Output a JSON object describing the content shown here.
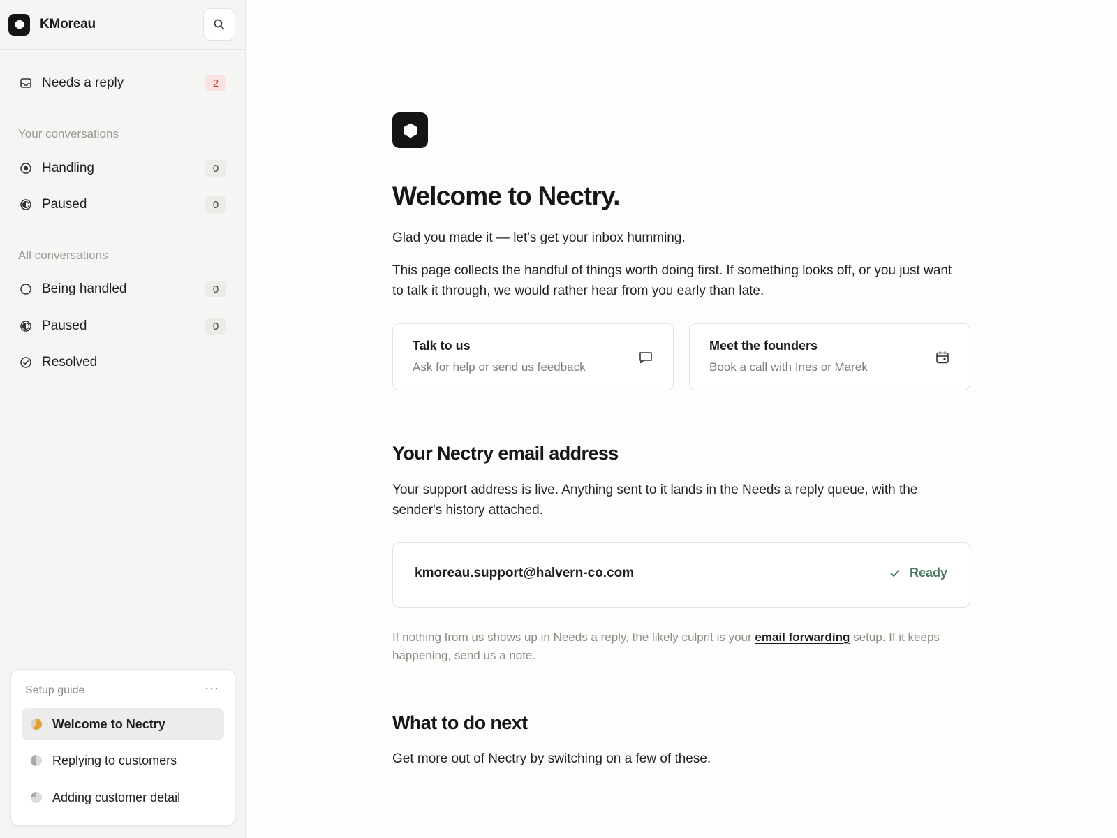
{
  "sidebar": {
    "org_name": "KMoreau",
    "needs_reply": {
      "label": "Needs a reply",
      "count": "2"
    },
    "your_section": "Your conversations",
    "your_items": [
      {
        "label": "Handling",
        "count": "0",
        "icon": "target-icon"
      },
      {
        "label": "Paused",
        "count": "0",
        "icon": "half-circle-icon"
      }
    ],
    "all_section": "All conversations",
    "all_items": [
      {
        "label": "Being handled",
        "count": "0",
        "icon": "circle-icon"
      },
      {
        "label": "Paused",
        "count": "0",
        "icon": "half-circle-icon"
      },
      {
        "label": "Resolved",
        "icon": "check-circle-icon"
      }
    ],
    "guide": {
      "title": "Setup guide",
      "more": "···",
      "items": [
        {
          "label": "Welcome to Nectry",
          "active": true
        },
        {
          "label": "Replying to customers"
        },
        {
          "label": "Adding customer detail"
        }
      ]
    }
  },
  "main": {
    "title": "Welcome to Nectry.",
    "intro": "Glad you made it — let's get your inbox humming.",
    "body": "This page collects the handful of things worth doing first. If something looks off, or you just want to talk it through, we would rather hear from you early than late.",
    "cards": [
      {
        "title": "Talk to us",
        "subtitle": "Ask for help or send us feedback",
        "icon": "chat-bubble-icon"
      },
      {
        "title": "Meet the founders",
        "subtitle": "Book a call with Ines or Marek",
        "icon": "calendar-icon"
      }
    ],
    "email_section": {
      "title": "Your Nectry email address",
      "body": "Your support address is live. Anything sent to it lands in the Needs a reply queue, with the sender's history attached.",
      "address": "kmoreau.support@halvern-co.com",
      "status": "Ready",
      "note_pre": "If nothing from us shows up in Needs a reply, the likely culprit is your ",
      "note_link": "email forwarding",
      "note_post": " setup. If it keeps happening, send us a note."
    },
    "next_section": {
      "title": "What to do next",
      "body": "Get more out of Nectry by switching on a few of these."
    }
  },
  "colors": {
    "accent_dark": "#141414",
    "alert_badge": "#c2413a",
    "ready_green": "#4a7a5c",
    "progress_amber": "#e0a33a"
  }
}
